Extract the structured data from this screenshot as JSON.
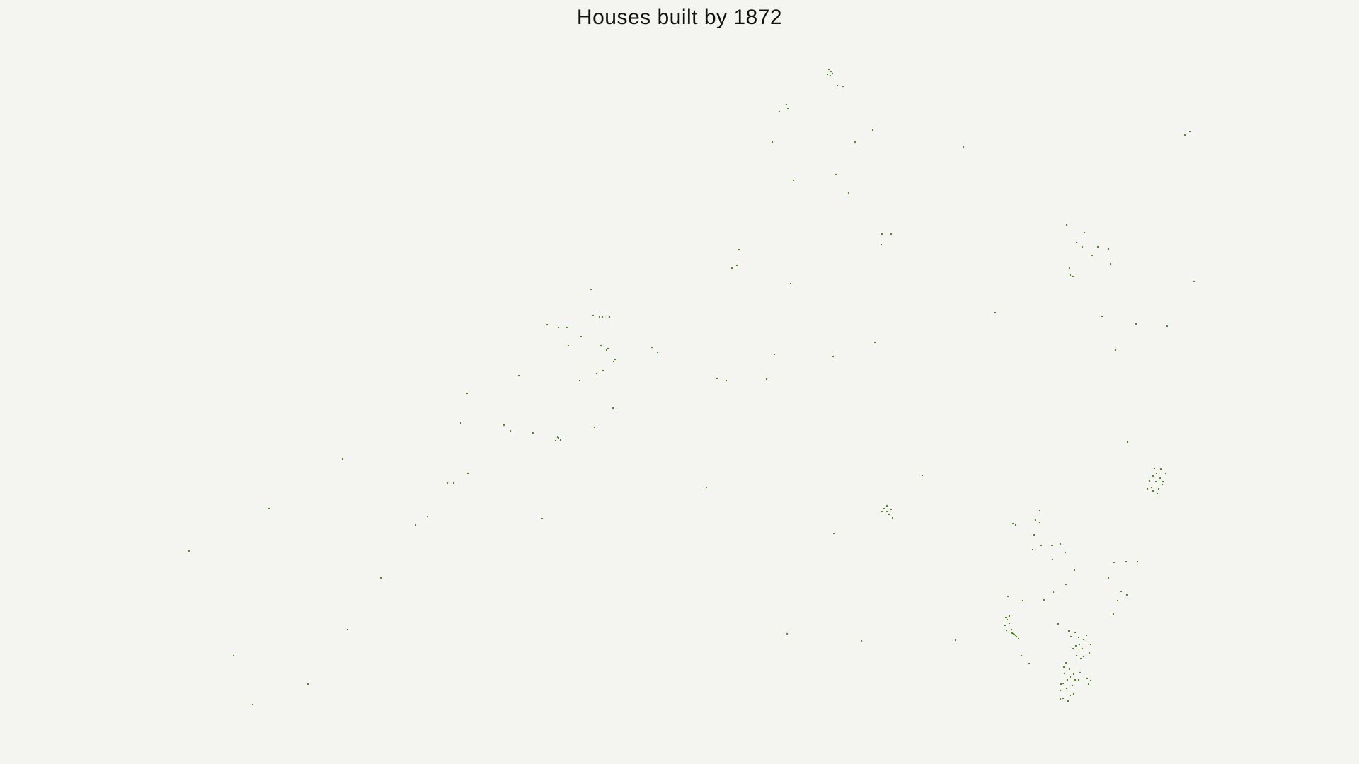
{
  "map": {
    "title": "Houses built by 1872",
    "background_color": "#f4f4f0",
    "point_color": "#4a8a1c",
    "point_count": 207
  }
}
